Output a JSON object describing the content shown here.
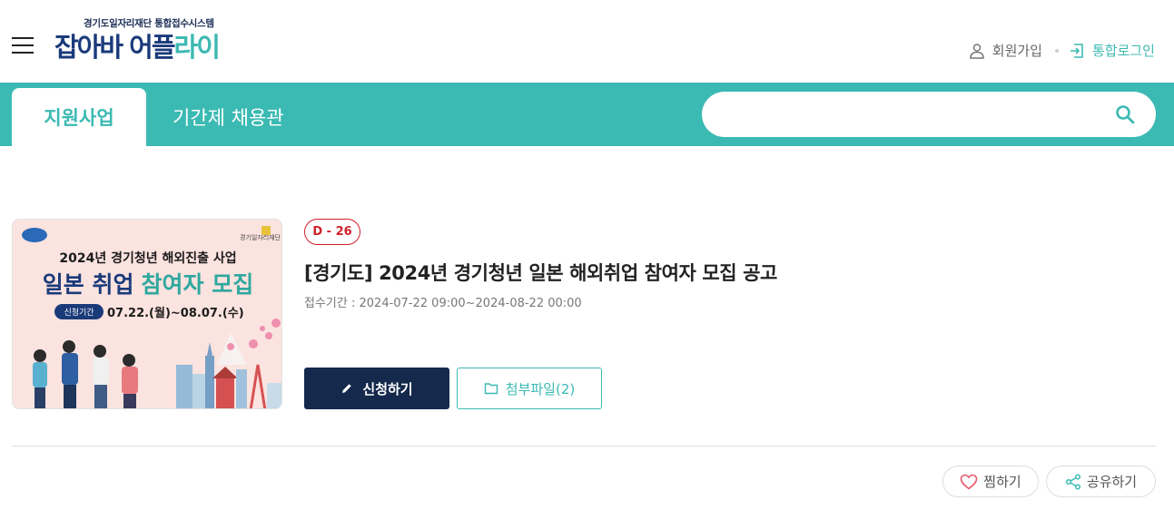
{
  "header": {
    "logo_sub": "경기도일자리재단 통합접수시스템",
    "logo_part1": "잡아바",
    "logo_part2a": "어플",
    "logo_part2b": "라이",
    "signup_label": "회원가입",
    "login_label": "통합로그인"
  },
  "tabs": [
    {
      "label": "지원사업",
      "active": true
    },
    {
      "label": "기간제 채용관",
      "active": false
    }
  ],
  "search": {
    "placeholder": "",
    "value": ""
  },
  "post": {
    "dday": "D - 26",
    "title": "[경기도] 2024년 경기청년 일본 해외취업 참여자 모집 공고",
    "period_label": "접수기간 :",
    "period_value": "2024-07-22 09:00~2024-08-22 00:00",
    "apply_label": "신청하기",
    "attach_label": "첨부파일(2)"
  },
  "poster": {
    "top_line": "2024년 경기청년 해외진출 사업",
    "headline_part1": "일본 취업",
    "headline_part2": "참여자 모집",
    "period_badge": "신청기간",
    "period_text": "07.22.(월)~08.07.(수)",
    "org": "경기일자리재단"
  },
  "actions": {
    "like_label": "찜하기",
    "share_label": "공유하기"
  },
  "colors": {
    "teal": "#3bbab3",
    "navy": "#14294b",
    "red": "#d0202b"
  }
}
